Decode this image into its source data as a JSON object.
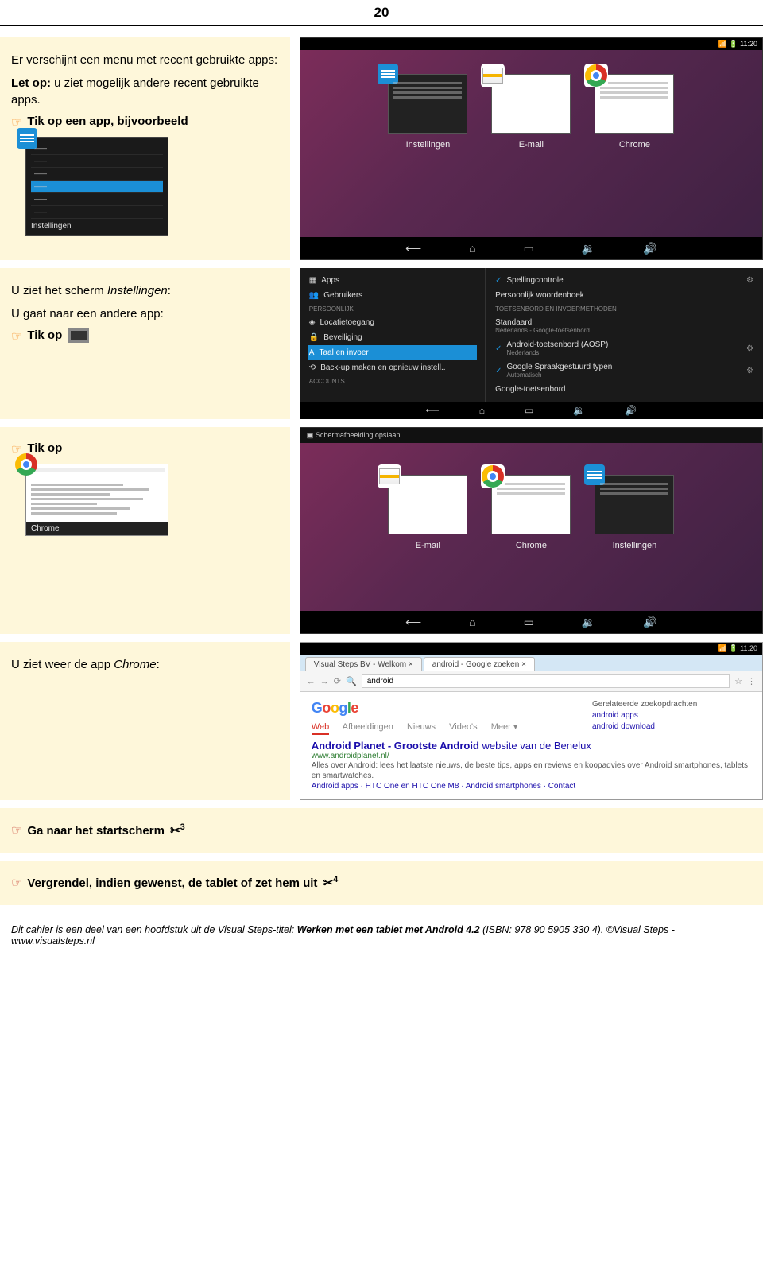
{
  "page_number": "20",
  "s1": {
    "p1": "Er verschijnt een menu met recent gebruikte apps:",
    "letop": "Let op:",
    "p2": " u ziet mogelijk andere recent gebruikte apps.",
    "instr": "Tik op een app, bijvoorbeeld",
    "settings_label": "Instellingen",
    "time": "11:20",
    "recents": {
      "a": "Instellingen",
      "b": "E-mail",
      "c": "Chrome"
    }
  },
  "s2": {
    "p1a": "U ziet het scherm ",
    "p1b": "Instellingen",
    "p2": "U gaat naar een andere app:",
    "instr": "Tik op",
    "left": {
      "apps": "Apps",
      "gebruikers": "Gebruikers",
      "persoonlijk": "PERSOONLIJK",
      "locatie": "Locatietoegang",
      "beveiliging": "Beveiliging",
      "taal": "Taal en invoer",
      "backup": "Back-up maken en opnieuw instell..",
      "accounts": "ACCOUNTS"
    },
    "right": {
      "spell": "Spellingcontrole",
      "woordenboek": "Persoonlijk woordenboek",
      "head": "TOETSENBORD EN INVOERMETHODEN",
      "standaard": "Standaard",
      "standaard_sub": "Nederlands - Google-toetsenbord",
      "aosp": "Android-toetsenbord (AOSP)",
      "aosp_sub": "Nederlands",
      "spraak": "Google Spraakgestuurd typen",
      "spraak_sub": "Automatisch",
      "gtoets": "Google-toetsenbord"
    }
  },
  "s3": {
    "instr": "Tik op",
    "chrome_label": "Chrome",
    "top": "Schermafbeelding opslaan...",
    "recents": {
      "a": "E-mail",
      "b": "Chrome",
      "c": "Instellingen"
    }
  },
  "s4": {
    "p1a": "U ziet weer de app ",
    "p1b": "Chrome",
    "time": "11:20",
    "tab1": "Visual Steps BV - Welkom",
    "tab2": "android - Google zoeken",
    "query": "android",
    "gtab_web": "Web",
    "gtab_afb": "Afbeeldingen",
    "gtab_nieuws": "Nieuws",
    "gtab_video": "Video's",
    "gtab_meer": "Meer ▾",
    "result_title_a": "Android Planet - Grootste Android",
    "result_title_b": " website van de Benelux",
    "result_url": "www.androidplanet.nl/",
    "result_snip": "Alles over Android: lees het laatste nieuws, de beste tips, apps en reviews en koopadvies over Android smartphones, tablets en smartwatches.",
    "result_links": "Android apps · HTC One en HTC One M8 · Android smartphones · Contact",
    "related_head": "Gerelateerde zoekopdrachten",
    "related_a": "android apps",
    "related_b": "android download"
  },
  "s5": {
    "instr": "Ga naar het startscherm",
    "ref": "3"
  },
  "s6": {
    "instr": "Vergrendel, indien gewenst, de tablet of zet hem uit",
    "ref": "4"
  },
  "footer": {
    "a": "Dit cahier is een deel van een hoofdstuk uit de Visual Steps-titel: ",
    "b": "Werken met een tablet met Android 4.2",
    "c": " (ISBN: 978 90 5905 330 4). ©Visual Steps - www.visualsteps.nl"
  }
}
